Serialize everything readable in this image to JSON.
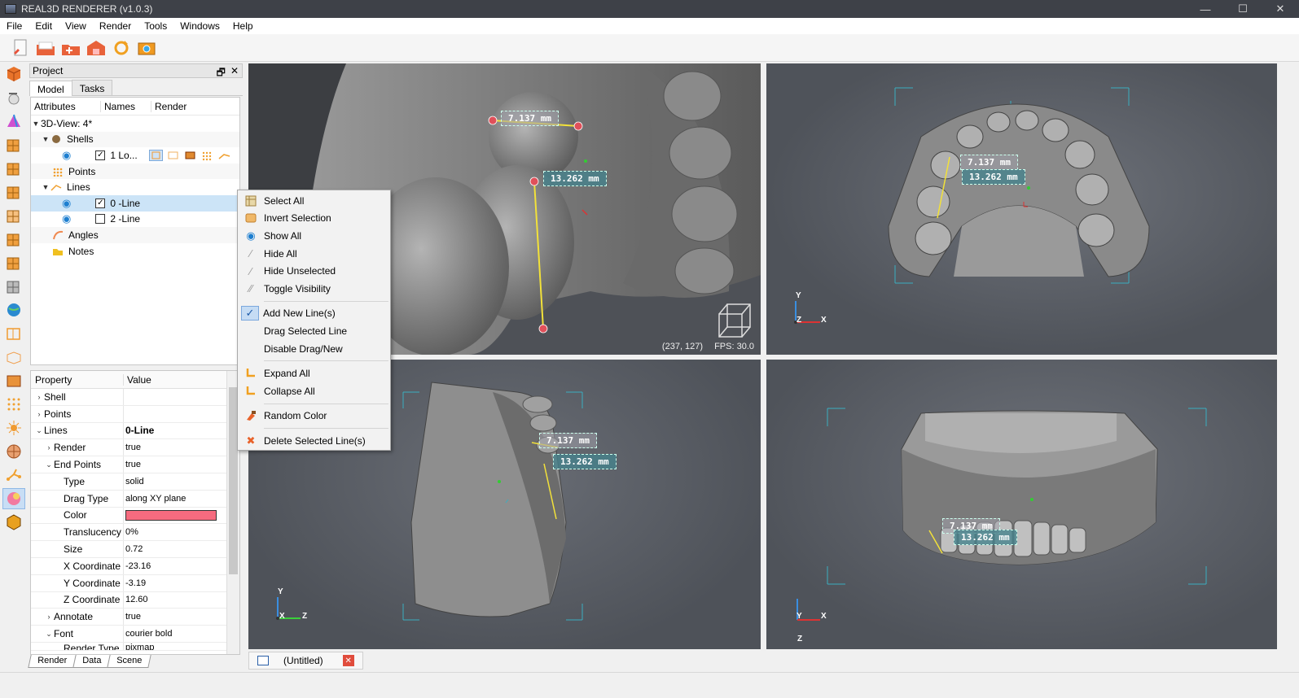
{
  "window": {
    "title": "REAL3D RENDERER (v1.0.3)",
    "minimize": "—",
    "maximize": "☐",
    "close": "✕"
  },
  "menubar": [
    "File",
    "Edit",
    "View",
    "Render",
    "Tools",
    "Windows",
    "Help"
  ],
  "toolbar": {
    "icons": [
      "new-doc-icon",
      "open-folder-icon",
      "add-model-icon",
      "export-icon",
      "refresh-icon",
      "screenshot-icon"
    ]
  },
  "project": {
    "title": "Project",
    "float_btn": "🗗",
    "close_btn": "✕",
    "tabs": [
      "Model",
      "Tasks"
    ],
    "tree_headers": [
      "Attributes",
      "Names",
      "Render"
    ],
    "tree": {
      "root": "3D-View: 4*",
      "shells": "Shells",
      "shell_item": "1 Lo...",
      "points": "Points",
      "lines": "Lines",
      "line0": "0 -Line",
      "line2": "2 -Line",
      "angles": "Angles",
      "notes": "Notes"
    }
  },
  "properties": {
    "headers": [
      "Property",
      "Value"
    ],
    "rows": {
      "shell": "Shell",
      "points": "Points",
      "lines": "Lines",
      "lines_val": "0-Line",
      "render": "Render",
      "render_val": "true",
      "endpoints": "End Points",
      "endpoints_val": "true",
      "type": "Type",
      "type_val": "solid",
      "dragtype": "Drag Type",
      "dragtype_val": "along XY plane",
      "color": "Color",
      "color_hex": "#f66b7f",
      "translucency": "Translucency",
      "translucency_val": "0%",
      "size": "Size",
      "size_val": "0.72",
      "xcoord": "X Coordinate",
      "xcoord_val": "-23.16",
      "ycoord": "Y Coordinate",
      "ycoord_val": "-3.19",
      "zcoord": "Z Coordinate",
      "zcoord_val": "12.60",
      "annotate": "Annotate",
      "annotate_val": "true",
      "font": "Font",
      "font_val": "courier bold",
      "rendertype": "Render Type",
      "rendertype_val": "pixmap"
    }
  },
  "bottom_tabs": [
    "Render",
    "Data",
    "Scene"
  ],
  "context_menu": {
    "select_all": "Select All",
    "invert_selection": "Invert Selection",
    "show_all": "Show All",
    "hide_all": "Hide All",
    "hide_unselected": "Hide Unselected",
    "toggle_visibility": "Toggle Visibility",
    "add_new_lines": "Add New Line(s)",
    "drag_selected_line": "Drag Selected Line",
    "disable_drag_new": "Disable Drag/New",
    "expand_all": "Expand All",
    "collapse_all": "Collapse All",
    "random_color": "Random Color",
    "delete_selected_lines": "Delete Selected Line(s)"
  },
  "viewports": {
    "measure_a": "7.137 mm",
    "measure_b": "13.262 mm",
    "cursor_pos": "(237, 127)",
    "fps": "FPS: 30.0",
    "axis": {
      "x": "X",
      "y": "Y",
      "z": "Z"
    }
  },
  "document_tab": {
    "label": "(Untitled)",
    "close": "✕"
  },
  "colors": {
    "accent": "#1e7fd0",
    "line": "#f2e13a",
    "endpoint": "#e0505a",
    "selected_row": "#cce4f7"
  }
}
